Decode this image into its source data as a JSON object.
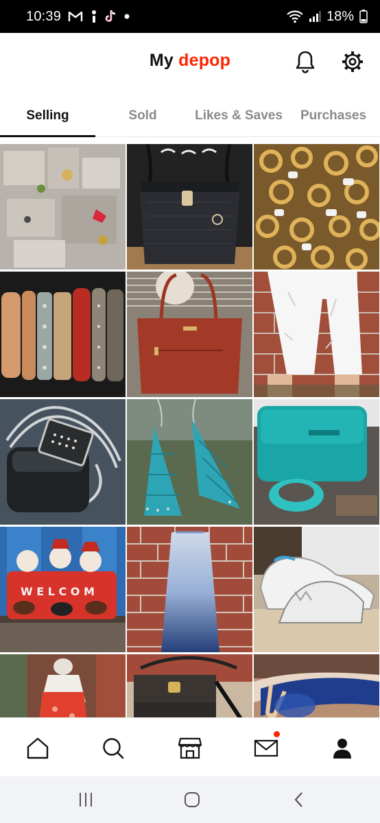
{
  "status_bar": {
    "time": "10:39",
    "battery": "18%",
    "notification_icons": [
      "gmail-icon",
      "activity-icon",
      "tiktok-icon",
      "dot-icon"
    ],
    "system_icons": [
      "wifi-icon",
      "signal-icon",
      "battery-icon"
    ]
  },
  "header": {
    "brand_prefix": "My",
    "brand_name": "depop",
    "brand_color": "#ff2300",
    "icons": [
      "bell-icon",
      "settings-gear-icon"
    ]
  },
  "tabs": [
    {
      "label": "Selling",
      "active": true
    },
    {
      "label": "Sold",
      "active": false
    },
    {
      "label": "Likes & Saves",
      "active": false
    },
    {
      "label": "Purchases",
      "active": false
    }
  ],
  "grid": {
    "items": [
      {
        "subject": "Bags of assorted jewelry"
      },
      {
        "subject": "Black embossed handbag"
      },
      {
        "subject": "Gold rings with tags"
      },
      {
        "subject": "Stacked bangle bracelets"
      },
      {
        "subject": "Red-brown leather tote"
      },
      {
        "subject": "White distressed capri jeans"
      },
      {
        "subject": "Silver chain pendant necklace"
      },
      {
        "subject": "Turquoise beaded earrings"
      },
      {
        "subject": "Teal wallet and bangle"
      },
      {
        "subject": "Snowman welcome decor"
      },
      {
        "subject": "Blue ombre maxi skirt"
      },
      {
        "subject": "White sneakers"
      },
      {
        "subject": "Red floral top"
      },
      {
        "subject": "Black monogram shoulder bag"
      },
      {
        "subject": "Blue sunglasses"
      }
    ]
  },
  "bottom_nav": {
    "items": [
      "home-icon",
      "search-icon",
      "shop-icon",
      "inbox-mail-icon",
      "profile-icon"
    ],
    "inbox_has_badge": true
  },
  "system_nav": {
    "items": [
      "recent-apps-icon",
      "home-circle-icon",
      "back-icon"
    ]
  }
}
